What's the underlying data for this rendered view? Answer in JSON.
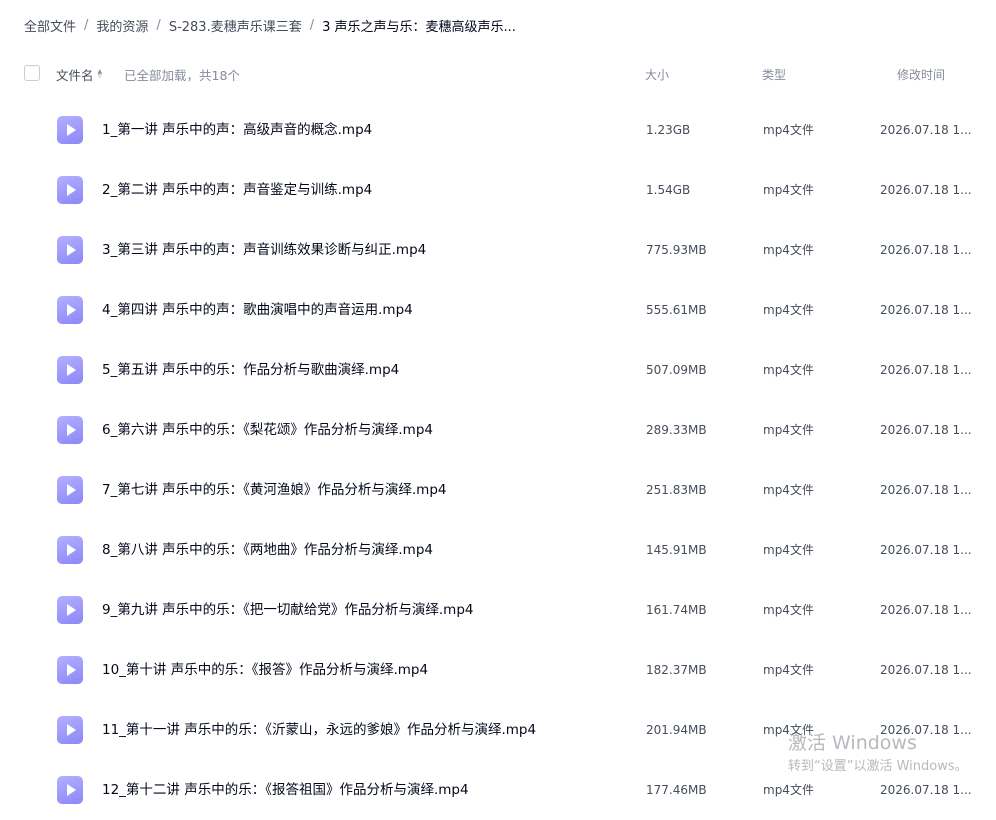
{
  "breadcrumb": [
    {
      "label": "全部文件"
    },
    {
      "label": "我的资源"
    },
    {
      "label": "S-283.麦穗声乐课三套"
    },
    {
      "label": "3 声乐之声与乐：麦穗高级声乐..."
    }
  ],
  "breadcrumb_separator": "/",
  "header": {
    "name_label": "文件名",
    "summary": "已全部加载，共18个",
    "size_label": "大小",
    "type_label": "类型",
    "time_label": "修改时间"
  },
  "files": [
    {
      "name": "1_第一讲 声乐中的声：高级声音的概念.mp4",
      "size": "1.23GB",
      "type": "mp4文件",
      "time": "2026.07.18 1..."
    },
    {
      "name": "2_第二讲 声乐中的声：声音鉴定与训练.mp4",
      "size": "1.54GB",
      "type": "mp4文件",
      "time": "2026.07.18 1..."
    },
    {
      "name": "3_第三讲 声乐中的声：声音训练效果诊断与纠正.mp4",
      "size": "775.93MB",
      "type": "mp4文件",
      "time": "2026.07.18 1..."
    },
    {
      "name": "4_第四讲 声乐中的声：歌曲演唱中的声音运用.mp4",
      "size": "555.61MB",
      "type": "mp4文件",
      "time": "2026.07.18 1..."
    },
    {
      "name": "5_第五讲 声乐中的乐：作品分析与歌曲演绎.mp4",
      "size": "507.09MB",
      "type": "mp4文件",
      "time": "2026.07.18 1..."
    },
    {
      "name": "6_第六讲 声乐中的乐：《梨花颂》作品分析与演绎.mp4",
      "size": "289.33MB",
      "type": "mp4文件",
      "time": "2026.07.18 1..."
    },
    {
      "name": "7_第七讲 声乐中的乐：《黄河渔娘》作品分析与演绎.mp4",
      "size": "251.83MB",
      "type": "mp4文件",
      "time": "2026.07.18 1..."
    },
    {
      "name": "8_第八讲 声乐中的乐：《两地曲》作品分析与演绎.mp4",
      "size": "145.91MB",
      "type": "mp4文件",
      "time": "2026.07.18 1..."
    },
    {
      "name": "9_第九讲 声乐中的乐：《把一切献给党》作品分析与演绎.mp4",
      "size": "161.74MB",
      "type": "mp4文件",
      "time": "2026.07.18 1..."
    },
    {
      "name": "10_第十讲 声乐中的乐：《报答》作品分析与演绎.mp4",
      "size": "182.37MB",
      "type": "mp4文件",
      "time": "2026.07.18 1..."
    },
    {
      "name": "11_第十一讲 声乐中的乐：《沂蒙山，永远的爹娘》作品分析与演绎.mp4",
      "size": "201.94MB",
      "type": "mp4文件",
      "time": "2026.07.18 1..."
    },
    {
      "name": "12_第十二讲 声乐中的乐：《报答祖国》作品分析与演绎.mp4",
      "size": "177.46MB",
      "type": "mp4文件",
      "time": "2026.07.18 1..."
    }
  ],
  "file_icon": "video-file-icon",
  "colors": {
    "accent_icon": "#9d9aff",
    "text_primary": "#03081a",
    "text_secondary": "#878c9c"
  },
  "watermark": {
    "title": "激活 Windows",
    "subtitle": "转到“设置”以激活 Windows。"
  }
}
